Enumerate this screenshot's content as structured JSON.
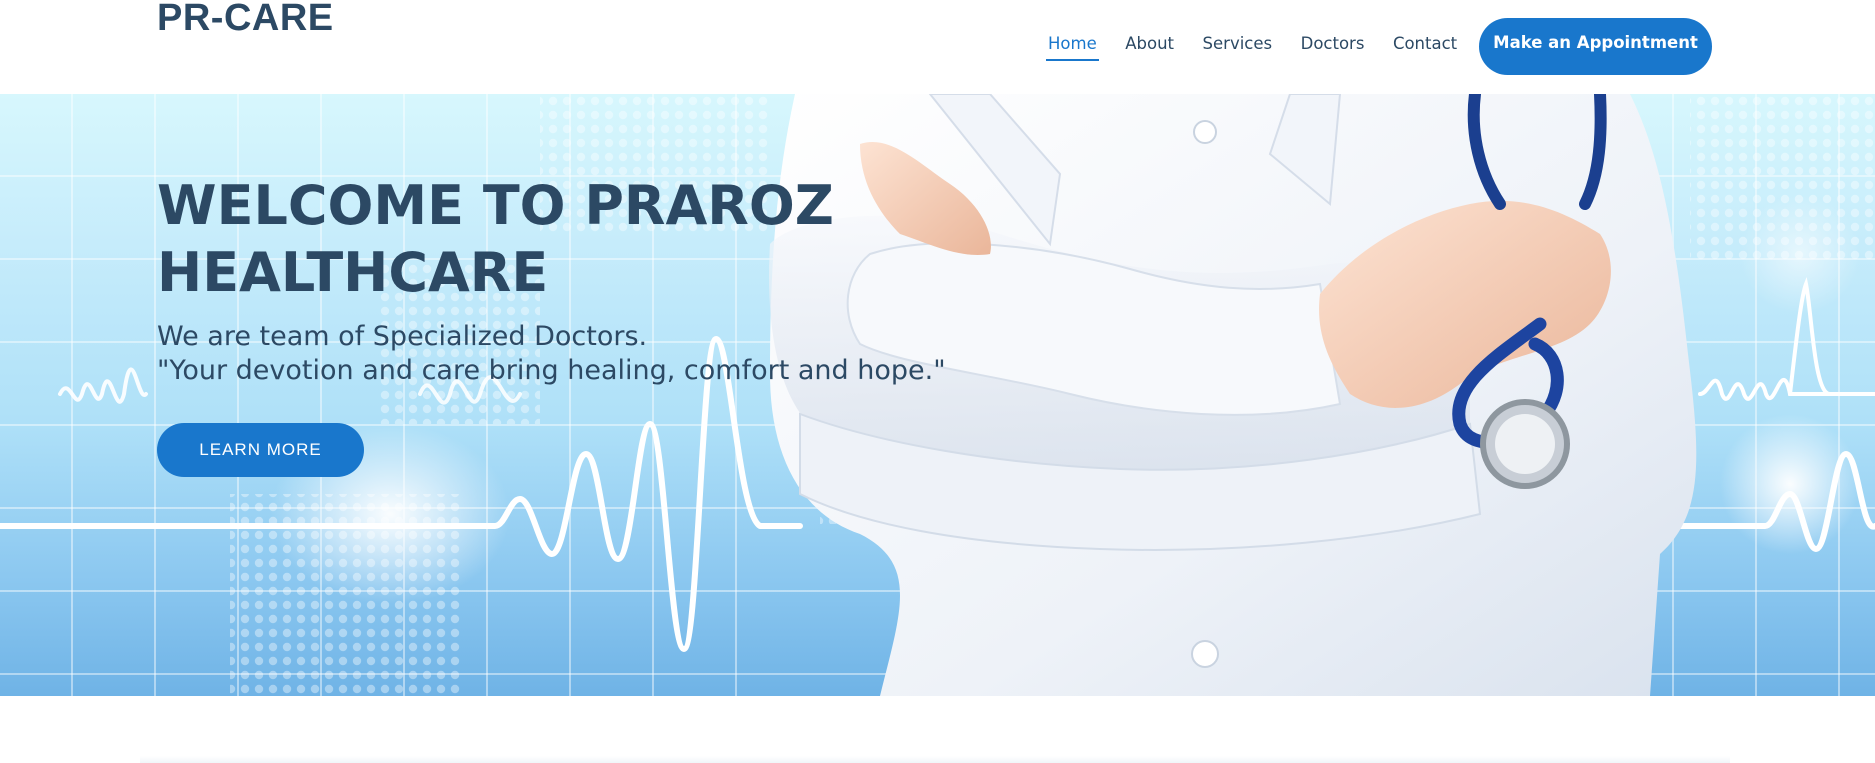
{
  "header": {
    "logo": "PR-CARE",
    "nav": [
      {
        "label": "Home",
        "active": true
      },
      {
        "label": "About",
        "active": false
      },
      {
        "label": "Services",
        "active": false
      },
      {
        "label": "Doctors",
        "active": false
      },
      {
        "label": "Contact",
        "active": false
      }
    ],
    "appointment_label": "Make an Appointment"
  },
  "hero": {
    "title_line1": "WELCOME TO PRAROZ",
    "title_line2": "HEALTHCARE",
    "subtitle_line1": "We are team of Specialized Doctors.",
    "subtitle_line2": "\"Your devotion and care bring healing, comfort and hope.\"",
    "cta_label": "LEARN MORE",
    "image": "doctor-with-stethoscope-icon"
  },
  "colors": {
    "accent": "#1977cc",
    "heading": "#2c4964",
    "white": "#ffffff"
  }
}
